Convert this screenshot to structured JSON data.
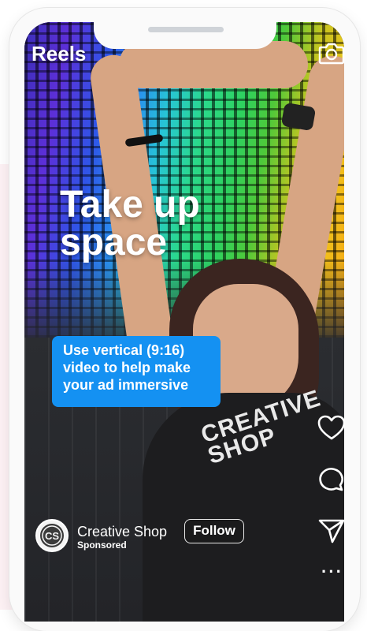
{
  "screen": {
    "title": "Reels",
    "headline": "Take up space",
    "callout": "Use vertical (9:16) video to help make your ad immersive"
  },
  "account": {
    "name": "Creative Shop",
    "sponsored_label": "Sponsored",
    "avatar_initials": "CS",
    "follow_label": "Follow"
  },
  "shirt_text": "CREATIVE SHOP",
  "icons": {
    "camera": "camera-icon",
    "like": "heart-icon",
    "comment": "comment-icon",
    "share": "send-icon",
    "more": "more-icon"
  },
  "more_glyph": "···",
  "colors": {
    "callout_background": "#1491f2",
    "text": "#ffffff"
  }
}
